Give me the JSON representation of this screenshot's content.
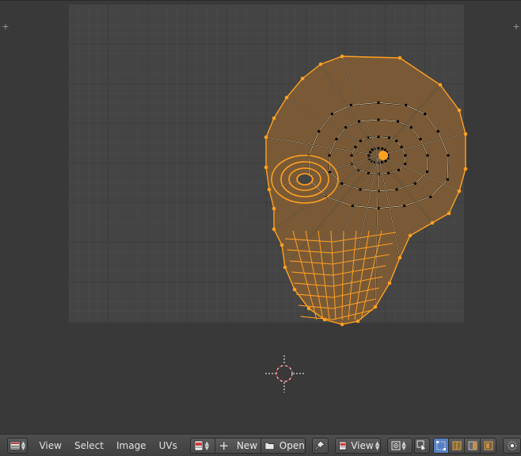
{
  "header": {
    "menus": [
      "View",
      "Select",
      "Image",
      "UVs"
    ],
    "new_label": "New",
    "open_label": "Open",
    "view_label": "View"
  },
  "icons": {
    "editor_type": "image-editor-icon",
    "new": "plus-icon",
    "open": "folder-icon",
    "pin": "pin-icon",
    "pivot": "pivot-icon",
    "sticky": "sticky-select-icon"
  },
  "colors": {
    "mesh_fill": "#7a5a36",
    "edge_select": "#ffa021",
    "background": "#393939",
    "grid_bg": "#444444",
    "active_toggle": "#5680c2"
  }
}
